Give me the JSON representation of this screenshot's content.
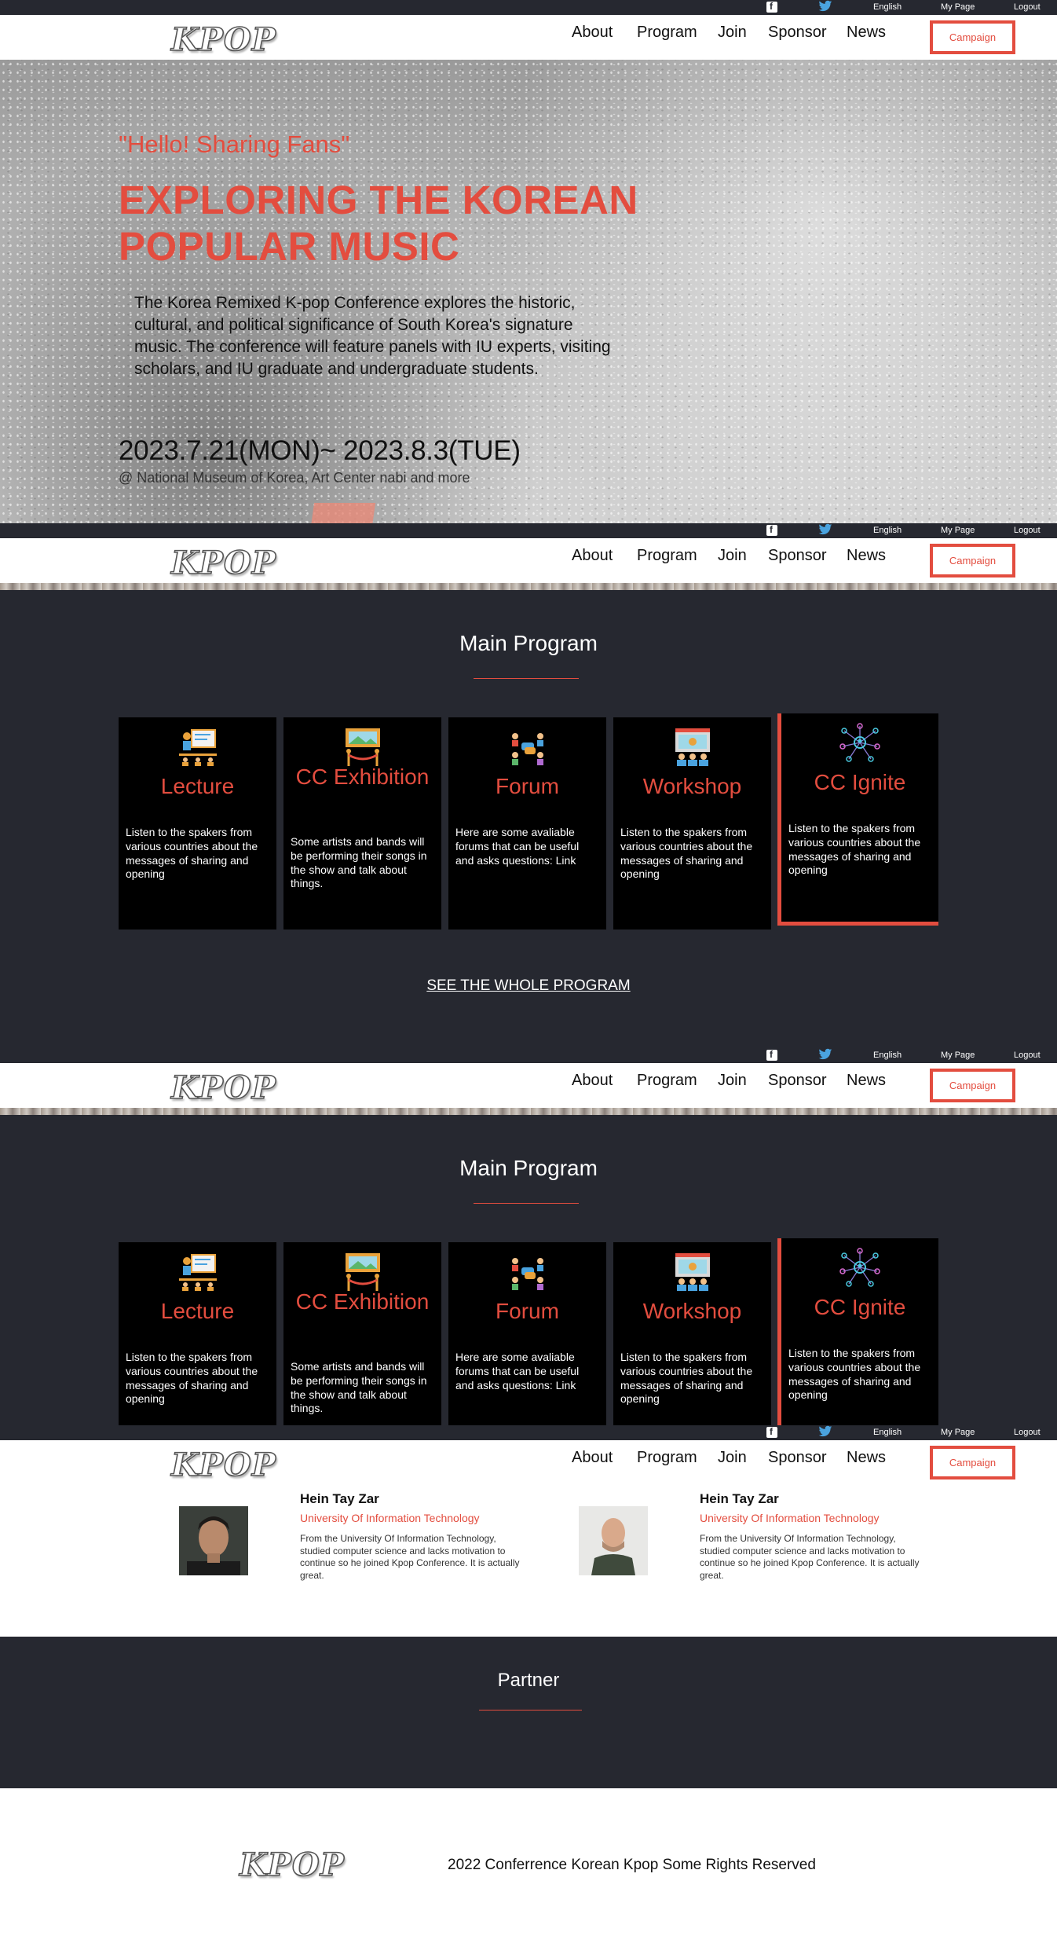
{
  "header": {
    "top_links": {
      "language": "English",
      "my_page": "My Page",
      "logout": "Logout"
    },
    "logo": "KPOP",
    "nav": [
      "About",
      "Program",
      "Join",
      "Sponsor",
      "News"
    ],
    "campaign_label": "Campaign",
    "social_icons": [
      "facebook-icon",
      "twitter-icon"
    ]
  },
  "hero": {
    "greeting": "\"Hello! Sharing Fans\"",
    "title_line1": "EXPLORING THE KOREAN",
    "title_line2": "POPULAR MUSIC",
    "description": "The Korea Remixed K-pop Conference explores the historic, cultural, and political significance of South Korea's signature music. The conference will feature panels with IU experts, visiting scholars, and IU graduate and undergraduate students.",
    "dates": "2023.7.21(MON)~ 2023.8.3(TUE)",
    "venue": "@ National Museum of Korea, Art Center nabi and more"
  },
  "program": {
    "title": "Main Program",
    "cards": [
      {
        "icon": "lecture-icon",
        "name": "Lecture",
        "description": "Listen to the spakers from various countries about the messages of sharing and opening"
      },
      {
        "icon": "exhibition-icon",
        "name": "CC Exhibition",
        "description": "Some artists and bands will be performing their songs in the show and talk about things."
      },
      {
        "icon": "forum-icon",
        "name": "Forum",
        "description": "Here are some avaliable forums that can be useful and asks questions: Link"
      },
      {
        "icon": "workshop-icon",
        "name": "Workshop",
        "description": "Listen to the spakers from various countries about the messages of sharing and opening"
      },
      {
        "icon": "network-icon",
        "name": "CC Ignite",
        "description": "Listen to the spakers from various countries about the messages of sharing and opening"
      }
    ],
    "see_all": "SEE THE WHOLE PROGRAM"
  },
  "speakers": [
    {
      "name": "Hein Tay Zar",
      "org": "University Of Information Technology",
      "bio": "From the University Of Information Technology, studied computer science and lacks motivation to continue so he joined Kpop Conference. It is actually great."
    },
    {
      "name": "Hein Tay Zar",
      "org": "University Of Information Technology",
      "bio": "From the University Of Information Technology, studied computer science and lacks motivation to continue so he joined Kpop Conference. It is actually great."
    }
  ],
  "partner": {
    "title": "Partner"
  },
  "footer": {
    "logo": "KPOP",
    "copyright": "2022 Conferrence Korean Kpop Some Rights Reserved"
  },
  "colors": {
    "accent": "#e34d3f",
    "dark": "#262830",
    "card": "#000000"
  }
}
